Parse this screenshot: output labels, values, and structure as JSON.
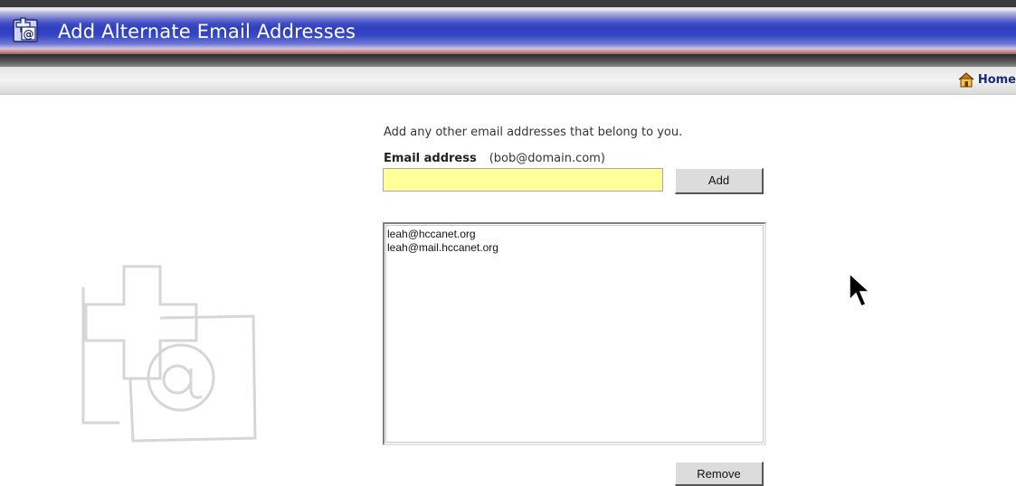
{
  "header": {
    "title": "Add Alternate Email Addresses",
    "icon": "add-email-icon"
  },
  "nav": {
    "home_label": "Home",
    "home_icon": "house-icon"
  },
  "form": {
    "intro": "Add any other email addresses that belong to you.",
    "email_label": "Email address",
    "email_hint": "(bob@domain.com)",
    "email_value": "",
    "email_placeholder": "",
    "add_label": "Add",
    "remove_label": "Remove",
    "input_color": "#ffff99"
  },
  "email_list": {
    "items": [
      "leah@hccanet.org",
      "leah@mail.hccanet.org"
    ]
  },
  "colors": {
    "titlebar_blue": "#2e3fc0",
    "home_link": "#1a2a7a"
  }
}
